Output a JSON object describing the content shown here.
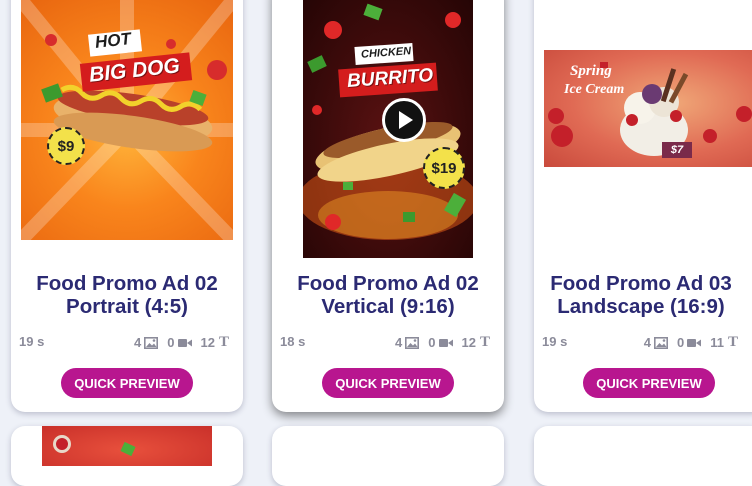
{
  "templates": [
    {
      "title_line1": "Food Promo Ad 02",
      "title_line2": "Portrait (4:5)",
      "duration": "19 s",
      "images": "4",
      "videos": "0",
      "texts": "12",
      "button": "QUICK PREVIEW",
      "thumb_text1": "HOT",
      "thumb_text2": "BIG DOG",
      "thumb_price": "$9"
    },
    {
      "title_line1": "Food Promo Ad 02",
      "title_line2": "Vertical (9:16)",
      "duration": "18 s",
      "images": "4",
      "videos": "0",
      "texts": "12",
      "button": "QUICK PREVIEW",
      "thumb_text1": "CHICKEN",
      "thumb_text2": "BURRITO",
      "thumb_price": "$19"
    },
    {
      "title_line1": "Food Promo Ad 03",
      "title_line2": "Landscape (16:9)",
      "duration": "19 s",
      "images": "4",
      "videos": "0",
      "texts": "11",
      "button": "QUICK PREVIEW",
      "thumb_text1": "Spring",
      "thumb_text2": "Ice Cream",
      "thumb_price": "$7"
    }
  ],
  "icons": {
    "image": "image-icon",
    "video": "video-icon",
    "text": "text-icon",
    "play": "play-icon"
  },
  "colors": {
    "title": "#2b2a73",
    "button": "#b8168f",
    "background": "#eef1f8"
  }
}
